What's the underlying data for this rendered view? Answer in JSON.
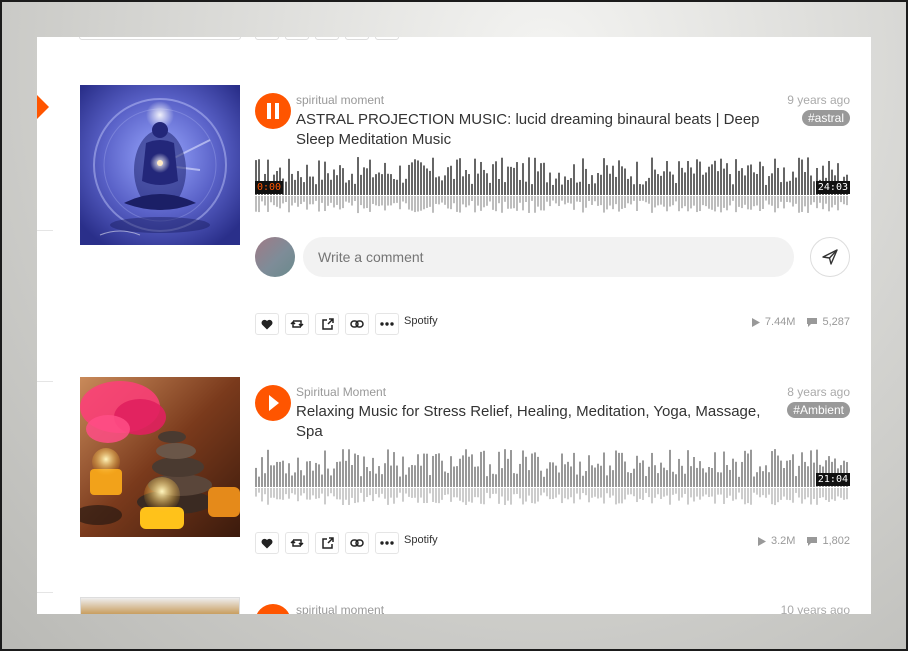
{
  "tracks": [
    {
      "user": "spiritual moment",
      "title": "ASTRAL PROJECTION MUSIC: lucid dreaming binaural beats | Deep Sleep Meditation Music",
      "age": "9 years ago",
      "tag": "#astral",
      "current_time": "0:00",
      "duration": "24:03",
      "plays": "7.44M",
      "comments": "5,287",
      "spotify_label": "Spotify",
      "state": "playing",
      "progress": 0.0
    },
    {
      "user": "Spiritual Moment",
      "title": "Relaxing Music for Stress Relief, Healing, Meditation, Yoga, Massage, Spa",
      "age": "8 years ago",
      "tag": "#Ambient",
      "duration": "21:04",
      "plays": "3.2M",
      "comments": "1,802",
      "spotify_label": "Spotify",
      "state": "paused"
    },
    {
      "user": "spiritual moment",
      "age": "10 years ago"
    }
  ],
  "comment": {
    "placeholder": "Write a comment"
  },
  "colors": {
    "accent": "#ff5500",
    "wave_played": "#666666",
    "wave_unplayed": "#999999",
    "tag_bg": "#999999"
  },
  "icons": [
    "pause-icon",
    "play-icon",
    "send-icon",
    "heart-icon",
    "repost-icon",
    "share-icon",
    "link-icon",
    "more-icon",
    "plays-icon",
    "comments-icon"
  ]
}
